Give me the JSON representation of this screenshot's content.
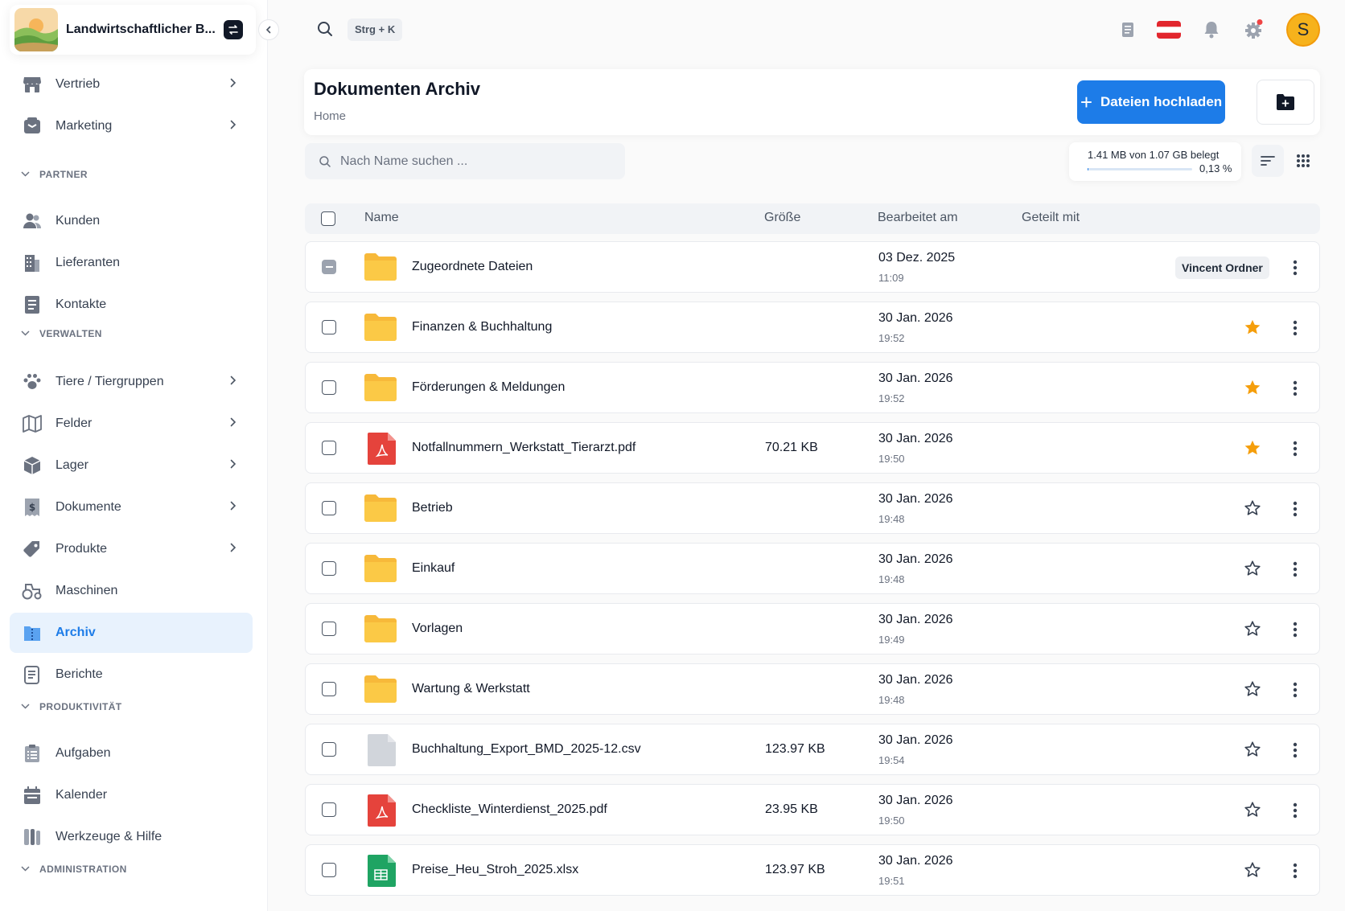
{
  "company": {
    "name": "Landwirtschaftlicher B..."
  },
  "nav": [
    {
      "label": "Vertrieb",
      "icon": "store-icon",
      "chevron": true
    },
    {
      "label": "Marketing",
      "icon": "megaphone-icon",
      "chevron": true
    },
    {
      "section": "PARTNER"
    },
    {
      "label": "Kunden",
      "icon": "users-icon",
      "chevron": false
    },
    {
      "label": "Lieferanten",
      "icon": "building-icon",
      "chevron": false
    },
    {
      "label": "Kontakte",
      "icon": "contact-book-icon",
      "chevron": false
    },
    {
      "section": "VERWALTEN"
    },
    {
      "label": "Tiere / Tiergruppen",
      "icon": "paw-icon",
      "chevron": true
    },
    {
      "label": "Felder",
      "icon": "map-icon",
      "chevron": true
    },
    {
      "label": "Lager",
      "icon": "box-icon",
      "chevron": true
    },
    {
      "label": "Dokumente",
      "icon": "invoice-icon",
      "chevron": true
    },
    {
      "label": "Produkte",
      "icon": "tag-icon",
      "chevron": true
    },
    {
      "label": "Maschinen",
      "icon": "tractor-icon",
      "chevron": false
    },
    {
      "label": "Archiv",
      "icon": "archive-icon",
      "chevron": false,
      "active": true
    },
    {
      "label": "Berichte",
      "icon": "report-icon",
      "chevron": false
    },
    {
      "section": "PRODUKTIVITÄT"
    },
    {
      "label": "Aufgaben",
      "icon": "tasks-icon",
      "chevron": false
    },
    {
      "label": "Kalender",
      "icon": "calendar-icon",
      "chevron": false
    },
    {
      "label": "Werkzeuge & Hilfe",
      "icon": "tools-icon",
      "chevron": false
    },
    {
      "section": "ADMINISTRATION"
    }
  ],
  "topbar": {
    "shortcut": "Strg + K",
    "avatar_initial": "S"
  },
  "header": {
    "title": "Dokumenten Archiv",
    "breadcrumb": "Home",
    "upload_label": "Dateien hochladen"
  },
  "search": {
    "placeholder": "Nach Name suchen ..."
  },
  "storage": {
    "text": "1.41 MB von 1.07 GB belegt",
    "percent_label": "0,13 %",
    "percent": 0.13
  },
  "table": {
    "headers": {
      "name": "Name",
      "size": "Größe",
      "modified": "Bearbeitet am",
      "shared": "Geteilt mit"
    },
    "rows": [
      {
        "type": "folder",
        "name": "Zugeordnete Dateien",
        "size": "",
        "date": "03 Dez. 2025",
        "time": "11:09",
        "shared": "Vincent Ordner",
        "starred": null,
        "indeterminate": true
      },
      {
        "type": "folder",
        "name": "Finanzen & Buchhaltung",
        "size": "",
        "date": "30 Jan. 2026",
        "time": "19:52",
        "shared": "",
        "starred": true
      },
      {
        "type": "folder",
        "name": "Förderungen & Meldungen",
        "size": "",
        "date": "30 Jan. 2026",
        "time": "19:52",
        "shared": "",
        "starred": true
      },
      {
        "type": "pdf",
        "name": "Notfallnummern_Werkstatt_Tierarzt.pdf",
        "size": "70.21 KB",
        "date": "30 Jan. 2026",
        "time": "19:50",
        "shared": "",
        "starred": true
      },
      {
        "type": "folder",
        "name": "Betrieb",
        "size": "",
        "date": "30 Jan. 2026",
        "time": "19:48",
        "shared": "",
        "starred": false
      },
      {
        "type": "folder",
        "name": "Einkauf",
        "size": "",
        "date": "30 Jan. 2026",
        "time": "19:48",
        "shared": "",
        "starred": false
      },
      {
        "type": "folder",
        "name": "Vorlagen",
        "size": "",
        "date": "30 Jan. 2026",
        "time": "19:49",
        "shared": "",
        "starred": false
      },
      {
        "type": "folder",
        "name": "Wartung & Werkstatt",
        "size": "",
        "date": "30 Jan. 2026",
        "time": "19:48",
        "shared": "",
        "starred": false
      },
      {
        "type": "csv",
        "name": "Buchhaltung_Export_BMD_2025-12.csv",
        "size": "123.97 KB",
        "date": "30 Jan. 2026",
        "time": "19:54",
        "shared": "",
        "starred": false
      },
      {
        "type": "pdf",
        "name": "Checkliste_Winterdienst_2025.pdf",
        "size": "23.95 KB",
        "date": "30 Jan. 2026",
        "time": "19:50",
        "shared": "",
        "starred": false
      },
      {
        "type": "xlsx",
        "name": "Preise_Heu_Stroh_2025.xlsx",
        "size": "123.97 KB",
        "date": "30 Jan. 2026",
        "time": "19:51",
        "shared": "",
        "starred": false
      }
    ]
  },
  "colors": {
    "accent": "#1d7ce8",
    "folder": "#fbc946",
    "star": "#f59e0b",
    "pdf": "#e5433c",
    "xlsx": "#1fa463",
    "csv": "#d1d5db"
  }
}
